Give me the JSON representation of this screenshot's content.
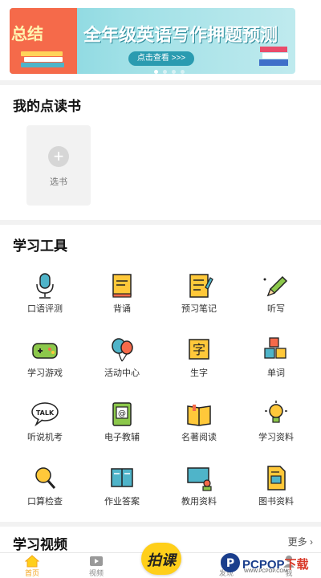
{
  "banner": {
    "left_title": "总结",
    "title": "全年级英语写作押题预测",
    "button": "点击查看 >>>",
    "colors": {
      "left_bg": "#f56a4a",
      "main_bg": "#9fe0e6",
      "button_bg": "#2a9bb0"
    }
  },
  "my_books": {
    "title": "我的点读书",
    "add_icon": "plus-icon",
    "add_label": "选书"
  },
  "tools": {
    "title": "学习工具",
    "items": [
      {
        "label": "口语评测",
        "icon": "microphone-icon"
      },
      {
        "label": "背诵",
        "icon": "book-icon"
      },
      {
        "label": "预习笔记",
        "icon": "notebook-icon"
      },
      {
        "label": "听写",
        "icon": "pencil-icon"
      },
      {
        "label": "学习游戏",
        "icon": "gamepad-icon"
      },
      {
        "label": "活动中心",
        "icon": "balloons-icon"
      },
      {
        "label": "生字",
        "icon": "character-card-icon"
      },
      {
        "label": "单词",
        "icon": "letter-blocks-icon"
      },
      {
        "label": "听说机考",
        "icon": "talk-bubble-icon"
      },
      {
        "label": "电子教辅",
        "icon": "ebook-icon"
      },
      {
        "label": "名著阅读",
        "icon": "open-book-icon"
      },
      {
        "label": "学习资料",
        "icon": "lightbulb-icon"
      },
      {
        "label": "口算检查",
        "icon": "magnifier-icon"
      },
      {
        "label": "作业答案",
        "icon": "answer-book-icon"
      },
      {
        "label": "教用资料",
        "icon": "teacher-board-icon"
      },
      {
        "label": "图书资料",
        "icon": "document-icon"
      }
    ]
  },
  "videos": {
    "title": "学习视频",
    "more": "更多"
  },
  "tabbar": {
    "items": [
      {
        "label": "首页",
        "icon": "home-icon",
        "active": true
      },
      {
        "label": "视频",
        "icon": "video-icon",
        "active": false
      },
      {
        "label": "发现",
        "icon": "discover-icon",
        "active": false
      },
      {
        "label": "我",
        "icon": "user-icon",
        "active": false
      }
    ],
    "snap_label": "拍课",
    "accent": "#ffcf1a"
  },
  "watermark": {
    "brand": "PCPOP",
    "suffix": "下载",
    "sub": "WWW.PCPOP.COM"
  }
}
